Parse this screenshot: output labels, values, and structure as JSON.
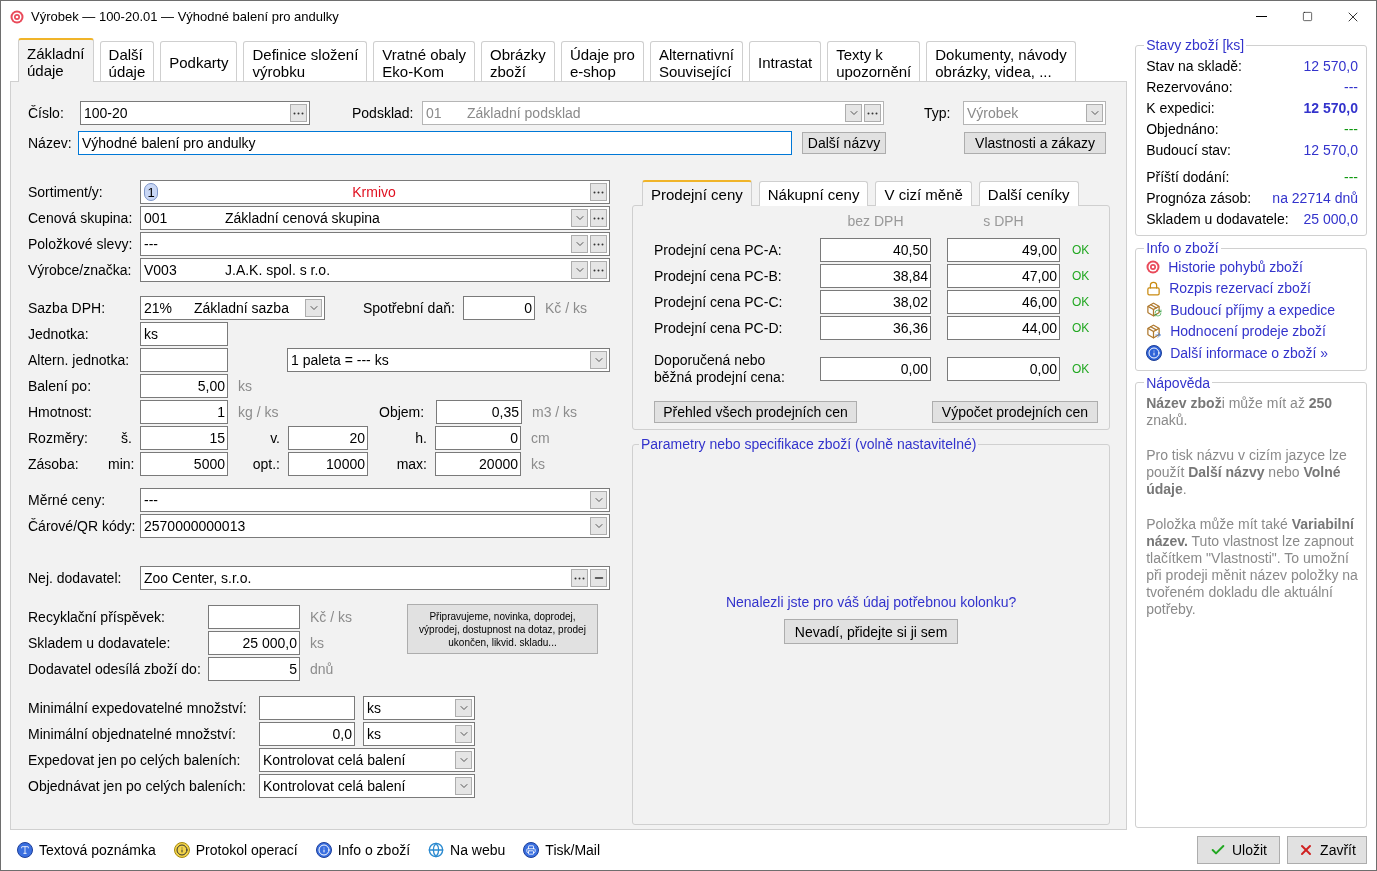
{
  "window": {
    "title": "Výrobek — 100-20.01 — Výhodné balení pro andulky"
  },
  "tabs": [
    {
      "lines": [
        "Základní",
        "údaje"
      ],
      "selected": true
    },
    {
      "lines": [
        "Další",
        "údaje"
      ],
      "selected": false
    },
    {
      "lines": [
        "Podkarty"
      ],
      "selected": false
    },
    {
      "lines": [
        "Definice složení",
        "výrobku"
      ],
      "selected": false
    },
    {
      "lines": [
        "Vratné obaly",
        "Eko-Kom"
      ],
      "selected": false
    },
    {
      "lines": [
        "Obrázky",
        "zboží"
      ],
      "selected": false
    },
    {
      "lines": [
        "Údaje pro",
        "e-shop"
      ],
      "selected": false
    },
    {
      "lines": [
        "Alternativní",
        "Související"
      ],
      "selected": false
    },
    {
      "lines": [
        "Intrastat"
      ],
      "selected": false
    },
    {
      "lines": [
        "Texty k",
        "upozornění"
      ],
      "selected": false
    },
    {
      "lines": [
        "Dokumenty, návody",
        "obrázky, videa, ..."
      ],
      "selected": false
    }
  ],
  "header": {
    "cislo": {
      "label": "Číslo:",
      "value": "100-20"
    },
    "podsklad": {
      "label": "Podsklad:",
      "code": "01",
      "name": "Základní podsklad",
      "disabled": true
    },
    "typ": {
      "label": "Typ:",
      "value": "Výrobek",
      "disabled": true
    },
    "nazev": {
      "label": "Název:",
      "value": "Výhodné balení pro andulky",
      "focused": true
    },
    "names_button": "Další názvy",
    "properties_button": "Vlastnosti a zákazy"
  },
  "classification": [
    {
      "kind": "assortment",
      "label": "Sortiment/y:",
      "badge": "1",
      "value": "Krmivo"
    },
    {
      "kind": "combo",
      "label": "Cenová skupina:",
      "code": "001",
      "name": "Základní cenová skupina"
    },
    {
      "kind": "combo",
      "label": "Položkové slevy:",
      "name": "---"
    },
    {
      "kind": "combo",
      "label": "Výrobce/značka:",
      "code": "V003",
      "name": "J.A.K. spol. s r.o."
    }
  ],
  "vat": {
    "label": "Sazba DPH:",
    "rate": "21%",
    "name": "Základní sazba"
  },
  "excise": {
    "label": "Spotřební daň:",
    "value": "0",
    "unit": "Kč / ks"
  },
  "unit": {
    "label": "Jednotka:",
    "value": "ks"
  },
  "alt_unit": {
    "label": "Altern. jednotka:",
    "conversion": "1 paleta = --- ks"
  },
  "packaging": {
    "label": "Balení po:",
    "value": "5,00",
    "unit": "ks"
  },
  "weight": {
    "label": "Hmotnost:",
    "value": "1",
    "unit": "kg / ks"
  },
  "volume": {
    "label": "Objem:",
    "value": "0,35",
    "unit": "m3 / ks"
  },
  "dimensions": {
    "label": "Rozměry:",
    "unit": "cm",
    "fields": [
      {
        "label": "š.",
        "value": "15"
      },
      {
        "label": "v.",
        "value": "20"
      },
      {
        "label": "h.",
        "value": "0"
      }
    ]
  },
  "stock_limits": {
    "label": "Zásoba:",
    "unit": "ks",
    "fields": [
      {
        "label": "min:",
        "value": "5000"
      },
      {
        "label": "opt.:",
        "value": "10000"
      },
      {
        "label": "max:",
        "value": "20000"
      }
    ]
  },
  "unit_prices": {
    "label": "Měrné ceny:",
    "value": "---"
  },
  "barcodes": {
    "label": "Čárové/QR kódy:",
    "value": "2570000000013"
  },
  "supplier": {
    "label": "Nej. dodavatel:",
    "value": "Zoo Center, s.r.o."
  },
  "supplier_fields": [
    {
      "label": "Recyklační příspěvek:",
      "unit": "Kč / ks"
    },
    {
      "label": "Skladem u dodavatele:",
      "value": "25 000,0",
      "unit": "ks"
    },
    {
      "label": "Dodavatel odesílá zboží do:",
      "value": "5",
      "unit": "dnů"
    }
  ],
  "status_button": "Připravujeme, novinka, doprodej, výprodej, dostupnost na dotaz, prodej ukončen, likvid. skladu...",
  "quantities": [
    {
      "kind": "amount",
      "label": "Minimální expedovatelné množství:",
      "unit": "ks"
    },
    {
      "kind": "amount",
      "label": "Minimální objednatelné množství:",
      "value": "0,0",
      "unit": "ks"
    },
    {
      "kind": "choice",
      "label": "Expedovat jen po celých baleních:",
      "value": "Kontrolovat celá balení"
    },
    {
      "kind": "choice",
      "label": "Objednávat jen po celých baleních:",
      "value": "Kontrolovat celá balení"
    }
  ],
  "price_tabs": [
    {
      "label": "Prodejní ceny",
      "selected": true
    },
    {
      "label": "Nákupní ceny",
      "selected": false
    },
    {
      "label": "V cizí měně",
      "selected": false
    },
    {
      "label": "Další ceníky",
      "selected": false
    }
  ],
  "prices": {
    "columns": [
      "bez DPH",
      "s DPH"
    ],
    "rows": [
      {
        "label": [
          "Prodejní cena PC-A:"
        ],
        "net": "40,50",
        "gross": "49,00",
        "status": "OK"
      },
      {
        "label": [
          "Prodejní cena PC-B:"
        ],
        "net": "38,84",
        "gross": "47,00",
        "status": "OK"
      },
      {
        "label": [
          "Prodejní cena PC-C:"
        ],
        "net": "38,02",
        "gross": "46,00",
        "status": "OK"
      },
      {
        "label": [
          "Prodejní cena PC-D:"
        ],
        "net": "36,36",
        "gross": "44,00",
        "status": "OK"
      }
    ],
    "recommended": {
      "label": [
        "Doporučená nebo",
        "běžná prodejní cena:"
      ],
      "net": "0,00",
      "gross": "0,00",
      "status": "OK"
    },
    "buttons": [
      "Přehled všech prodejních cen",
      "Výpočet prodejních cen"
    ]
  },
  "parameters": {
    "title": "Parametry nebo specifikace zboží (volně nastavitelné)",
    "question": "Nenalezli jste pro váš údaj potřebnou kolonku?",
    "button": "Nevadí, přidejte si ji sem"
  },
  "stock_status": {
    "title": "Stavy zboží [ks]",
    "rows": [
      {
        "label": "Stav na skladě:",
        "value": "12 570,0",
        "color": "#3333cc",
        "strong": false
      },
      {
        "label": "Rezervováno:",
        "value": "---",
        "color": "#3333cc",
        "strong": false
      },
      {
        "label": "K expedici:",
        "value": "12 570,0",
        "color": "#3333cc",
        "strong": true
      },
      {
        "label": "Objednáno:",
        "value": "---",
        "color": "#119911",
        "strong": false
      },
      {
        "label": "Budoucí stav:",
        "value": "12 570,0",
        "color": "#3333cc",
        "strong": false
      }
    ],
    "forecast": [
      {
        "label": "Příští dodání:",
        "value": "---",
        "color": "#119911"
      },
      {
        "label": "Prognóza zásob:",
        "value": "na 22714 dnů",
        "color": "#3333cc"
      },
      {
        "label": "Skladem u dodavatele:",
        "value": "25 000,0",
        "color": "#3333cc"
      }
    ]
  },
  "info": {
    "title": "Info o zboží",
    "links": [
      {
        "kind": "history",
        "label": "Historie pohybů zboží"
      },
      {
        "kind": "lock",
        "label": "Rozpis rezervací zboží"
      },
      {
        "kind": "box-in",
        "label": "Budoucí příjmy a expedice"
      },
      {
        "kind": "box-out",
        "label": "Hodnocení prodeje zboží"
      },
      {
        "kind": "info",
        "label": "Další informace o zboží »"
      }
    ]
  },
  "help": {
    "title": "Nápověda",
    "paragraphs": [
      "**Název zbož**i může mít až **250** znaků.",
      "Pro tisk názvu v cizím jazyce lze použít **Další názvy** nebo **Volné údaje**.",
      "Položka může mít také **Variabilní název.** Tuto vlastnost lze zapnout tlačítkem \"Vlastnosti\". To umožní při prodeji měnit název položky na tvořeném dokladu dle aktuální potřeby."
    ]
  },
  "footer": {
    "links": [
      {
        "kind": "note",
        "label": "Textová poznámka"
      },
      {
        "kind": "protocol",
        "label": "Protokol operací"
      },
      {
        "kind": "info",
        "label": "Info o zboží"
      },
      {
        "kind": "web",
        "label": "Na webu"
      },
      {
        "kind": "print",
        "label": "Tisk/Mail"
      }
    ],
    "buttons": [
      {
        "kind": "save",
        "label": "Uložit"
      },
      {
        "kind": "close",
        "label": "Zavřít"
      }
    ]
  }
}
